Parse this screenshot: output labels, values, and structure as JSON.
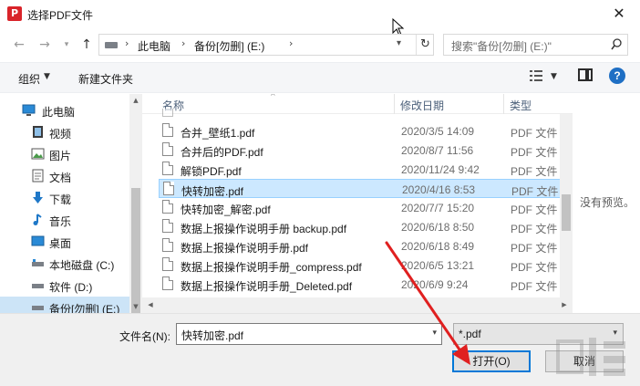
{
  "window": {
    "title": "选择PDF文件",
    "app_logo": "P"
  },
  "nav": {
    "crumbs": [
      "此电脑",
      "备份[勿删] (E:)"
    ],
    "search_placeholder": "搜索\"备份[勿删] (E:)\""
  },
  "toolbar": {
    "organize": "组织",
    "new_folder": "新建文件夹"
  },
  "sidebar": {
    "items": [
      {
        "label": "此电脑",
        "icon": "computer-icon"
      },
      {
        "label": "视频",
        "icon": "video-icon"
      },
      {
        "label": "图片",
        "icon": "pictures-icon"
      },
      {
        "label": "文档",
        "icon": "documents-icon"
      },
      {
        "label": "下载",
        "icon": "download-icon"
      },
      {
        "label": "音乐",
        "icon": "music-icon"
      },
      {
        "label": "桌面",
        "icon": "desktop-icon"
      },
      {
        "label": "本地磁盘 (C:)",
        "icon": "drive-icon"
      },
      {
        "label": "软件 (D:)",
        "icon": "drive-icon"
      },
      {
        "label": "备份[勿删] (E:)",
        "icon": "drive-icon"
      }
    ]
  },
  "columns": {
    "name": "名称",
    "date": "修改日期",
    "type": "类型"
  },
  "files": [
    {
      "name": "合并_壁纸1.pdf",
      "date": "2020/3/5 14:09",
      "type": "PDF 文件"
    },
    {
      "name": "合并后的PDF.pdf",
      "date": "2020/8/7 11:56",
      "type": "PDF 文件"
    },
    {
      "name": "解锁PDF.pdf",
      "date": "2020/11/24 9:42",
      "type": "PDF 文件"
    },
    {
      "name": "快转加密.pdf",
      "date": "2020/4/16 8:53",
      "type": "PDF 文件"
    },
    {
      "name": "快转加密_解密.pdf",
      "date": "2020/7/7 15:20",
      "type": "PDF 文件"
    },
    {
      "name": "数据上报操作说明手册 backup.pdf",
      "date": "2020/6/18 8:50",
      "type": "PDF 文件"
    },
    {
      "name": "数据上报操作说明手册.pdf",
      "date": "2020/6/18 8:49",
      "type": "PDF 文件"
    },
    {
      "name": "数据上报操作说明手册_compress.pdf",
      "date": "2020/6/5 13:21",
      "type": "PDF 文件"
    },
    {
      "name": "数据上报操作说明手册_Deleted.pdf",
      "date": "2020/6/9 9:24",
      "type": "PDF 文件"
    }
  ],
  "preview": {
    "empty_text": "没有预览。"
  },
  "bottom": {
    "filename_label": "文件名(N):",
    "filename_value": "快转加密.pdf",
    "filetype_value": "*.pdf",
    "open_label": "打开(O)",
    "cancel_label": "取消"
  },
  "colors": {
    "accent": "#0078d7",
    "selection": "#cce8ff",
    "annotation_arrow": "#e02020"
  }
}
